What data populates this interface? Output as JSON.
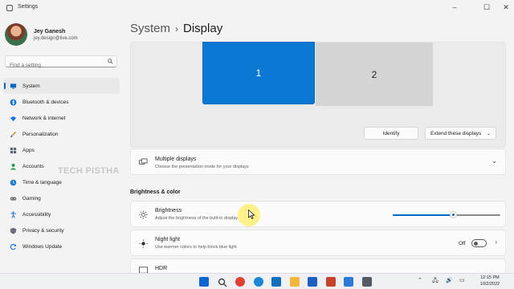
{
  "window": {
    "title": "Settings",
    "controls": {
      "minimize": "–",
      "maximize": "☐",
      "close": "✕"
    }
  },
  "user": {
    "name": "Jey Ganesh",
    "email": "jey.design@live.com"
  },
  "search": {
    "placeholder": "Find a setting",
    "value": ""
  },
  "sidebar": {
    "items": [
      {
        "label": "System",
        "icon": "monitor-icon",
        "active": true
      },
      {
        "label": "Bluetooth & devices",
        "icon": "bluetooth-icon"
      },
      {
        "label": "Network & internet",
        "icon": "wifi-icon"
      },
      {
        "label": "Personalization",
        "icon": "brush-icon"
      },
      {
        "label": "Apps",
        "icon": "apps-icon"
      },
      {
        "label": "Accounts",
        "icon": "person-icon"
      },
      {
        "label": "Time & language",
        "icon": "globe-clock-icon"
      },
      {
        "label": "Gaming",
        "icon": "gamepad-icon"
      },
      {
        "label": "Accessibility",
        "icon": "accessibility-icon"
      },
      {
        "label": "Privacy & security",
        "icon": "shield-icon"
      },
      {
        "label": "Windows Update",
        "icon": "update-icon"
      }
    ]
  },
  "watermark": "TECH PISTHA",
  "breadcrumb": {
    "parent": "System",
    "separator": "›",
    "current": "Display"
  },
  "monitors": {
    "primary": "1",
    "secondary": "2"
  },
  "monitor_actions": {
    "identify": "Identify",
    "extend": "Extend these displays",
    "extend_chevron": "⌄"
  },
  "multiple_displays": {
    "title": "Multiple displays",
    "subtitle": "Choose the presentation mode for your displays",
    "chevron": "⌄"
  },
  "brightness_color": {
    "heading": "Brightness & color",
    "brightness": {
      "title": "Brightness",
      "subtitle": "Adjust the brightness of the built-in display",
      "value_fraction": 0.56
    },
    "night_light": {
      "title": "Night light",
      "subtitle": "Use warmer colors to help block blue light",
      "state": "Off",
      "chevron": "›"
    },
    "hdr": {
      "title": "HDR"
    }
  },
  "taskbar": {
    "apps": [
      {
        "name": "start-icon",
        "color": "#0a64d2"
      },
      {
        "name": "search-icon",
        "color": "#2b2b2b"
      },
      {
        "name": "chrome-icon",
        "color": "#e0402f"
      },
      {
        "name": "edge-icon",
        "color": "#1987d6"
      },
      {
        "name": "outlook-icon",
        "color": "#0f6ebd"
      },
      {
        "name": "file-explorer-icon",
        "color": "#f4b73b"
      },
      {
        "name": "word-icon",
        "color": "#1e5fc0"
      },
      {
        "name": "powerpoint-icon",
        "color": "#c4432a"
      },
      {
        "name": "photos-icon",
        "color": "#2a7ad6"
      },
      {
        "name": "settings-icon",
        "color": "#555a63"
      }
    ],
    "tray_glyphs": {
      "chevron": "⌃",
      "network": "🖧",
      "volume": "🔊",
      "battery": "▭"
    },
    "time": "12:15 PM",
    "date": "10/2/2022"
  }
}
